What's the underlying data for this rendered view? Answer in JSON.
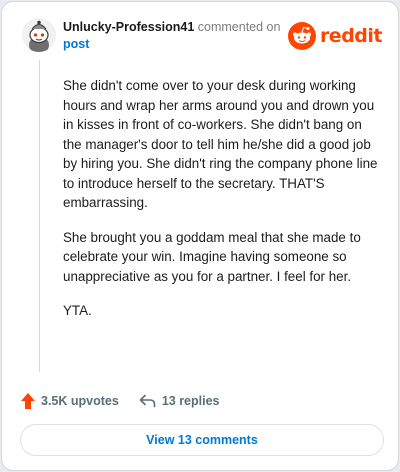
{
  "comment": {
    "username": "Unlucky-Profession41",
    "action_text": "commented on",
    "post_link": "post",
    "brand": "reddit",
    "paragraphs": [
      "She didn't come over to your desk during working hours and wrap her arms around you and drown you in kisses in front of co-workers. She didn't bang on the manager's door to tell him he/she did a good job by hiring you. She didn't ring the company phone line to introduce herself to the secretary. THAT'S embarrassing.",
      "She brought you a goddam meal that she made to celebrate your win. Imagine having someone so unappreciative as you for a partner. I feel for her.",
      "YTA."
    ],
    "upvotes": "3.5K upvotes",
    "replies": "13 replies",
    "view_comments": "View 13 comments"
  },
  "colors": {
    "brand": "#ff4500",
    "link": "#0079d3",
    "muted": "#576f76"
  },
  "icons": {
    "avatar": "snoo-avatar",
    "brand": "reddit-logo-icon",
    "upvote": "upvote-arrow-icon",
    "reply": "reply-arrow-icon"
  }
}
